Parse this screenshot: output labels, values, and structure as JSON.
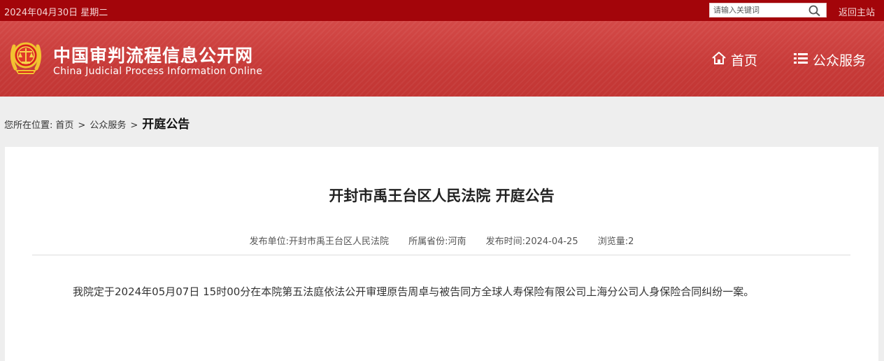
{
  "topbar": {
    "date": "2024年04月30日 星期二",
    "search_placeholder": "请输入关键词",
    "return_label": "返回主站"
  },
  "header": {
    "title_cn": "中国审判流程信息公开网",
    "title_en": "China Judicial Process Information Online",
    "nav": [
      {
        "label": "首页",
        "icon": "home-icon"
      },
      {
        "label": "公众服务",
        "icon": "list-icon"
      }
    ]
  },
  "breadcrumb": {
    "prefix": "您所在位置:",
    "items": [
      "首页",
      "公众服务"
    ],
    "separator": ">",
    "current": "开庭公告"
  },
  "notice": {
    "title": "开封市禹王台区人民法院 开庭公告",
    "meta": {
      "publisher_label": "发布单位:",
      "publisher": "开封市禹王台区人民法院",
      "province_label": "所属省份:",
      "province": "河南",
      "date_label": "发布时间:",
      "date": "2024-04-25",
      "views_label": "浏览量:",
      "views": "2"
    },
    "body": "我院定于2024年05月07日 15时00分在本院第五法庭依法公开审理原告周卓与被告同方全球人寿保险有限公司上海分公司人身保险合同纠纷一案。"
  },
  "colors": {
    "topbar_bg": "#a3050a",
    "banner_bg": "#c73a38",
    "page_bg": "#eeeeee",
    "card_bg": "#ffffff"
  }
}
